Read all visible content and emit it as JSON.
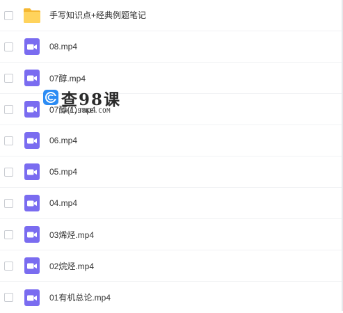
{
  "files": [
    {
      "name": "手写知识点+经典例题笔记",
      "type": "folder-icon"
    },
    {
      "name": "08.mp4",
      "type": "video-icon"
    },
    {
      "name": "07醇.mp4",
      "type": "video-icon"
    },
    {
      "name": "07醇(1).mp4",
      "type": "video-icon"
    },
    {
      "name": "06.mp4",
      "type": "video-icon"
    },
    {
      "name": "05.mp4",
      "type": "video-icon"
    },
    {
      "name": "04.mp4",
      "type": "video-icon"
    },
    {
      "name": "03烯烃.mp4",
      "type": "video-icon"
    },
    {
      "name": "02烷烃.mp4",
      "type": "video-icon"
    },
    {
      "name": "01有机总论.mp4",
      "type": "video-icon"
    }
  ],
  "watermark": {
    "title": "查98课",
    "subtitle": "CHA.98KE.COM"
  },
  "colors": {
    "folder": "#ffc94d",
    "video": "#7a6cf0",
    "text": "#333333",
    "checkbox_border": "#c9ccd2",
    "logo": "#2c8cf4"
  }
}
